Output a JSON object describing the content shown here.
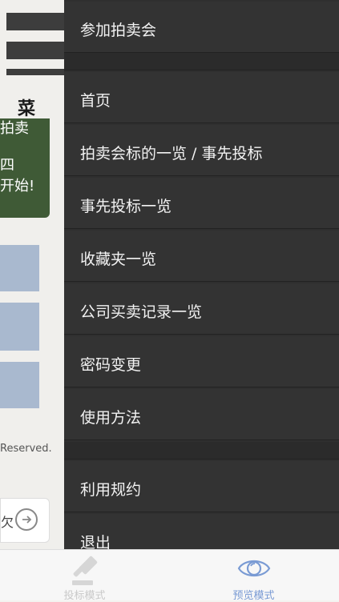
{
  "background_page": {
    "menu_label": "菜",
    "banner_line1": "拍卖",
    "banner_line2": "四",
    "banner_line3": "开始!",
    "copyright": "Reserved.",
    "next_label": "欠"
  },
  "drawer": {
    "items": [
      {
        "label": "参加拍卖会"
      },
      {
        "label": "首页"
      },
      {
        "label": "拍卖会标的一览 / 事先投标"
      },
      {
        "label": "事先投标一览"
      },
      {
        "label": "收藏夹一览"
      },
      {
        "label": "公司买卖记录一览"
      },
      {
        "label": "密码变更"
      },
      {
        "label": "使用方法"
      },
      {
        "label": "利用规约"
      },
      {
        "label": "退出"
      }
    ]
  },
  "tabbar": {
    "tabs": [
      {
        "label": "投标模式",
        "icon": "gavel-icon",
        "active": false
      },
      {
        "label": "预览模式",
        "icon": "eye-icon",
        "active": true
      }
    ]
  },
  "colors": {
    "drawer_bg": "#333333",
    "active_tab": "#7a9bd4",
    "inactive_tab": "#c9c9c9",
    "banner_green": "#3f5a36"
  }
}
